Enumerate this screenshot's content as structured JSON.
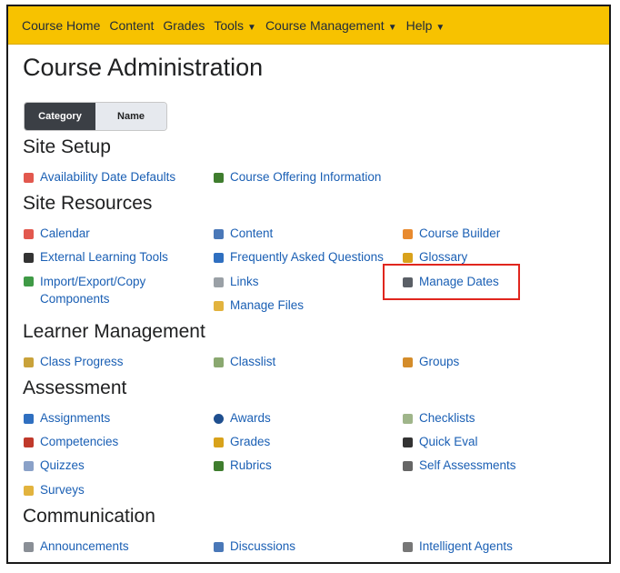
{
  "nav": {
    "items": [
      {
        "label": "Course Home",
        "dropdown": false
      },
      {
        "label": "Content",
        "dropdown": false
      },
      {
        "label": "Grades",
        "dropdown": false
      },
      {
        "label": "Tools",
        "dropdown": true
      },
      {
        "label": "Course Management",
        "dropdown": true
      },
      {
        "label": "Help",
        "dropdown": true
      }
    ],
    "chevron": "⌄"
  },
  "page": {
    "title": "Course Administration"
  },
  "view_toggle": {
    "category_label": "Category",
    "name_label": "Name",
    "selected": "Category"
  },
  "sections": {
    "site_setup": {
      "title": "Site Setup",
      "links": {
        "availability_date_defaults": "Availability Date Defaults",
        "course_offering_information": "Course Offering Information"
      }
    },
    "site_resources": {
      "title": "Site Resources",
      "links": {
        "calendar": "Calendar",
        "content": "Content",
        "course_builder": "Course Builder",
        "external_learning_tools": "External Learning Tools",
        "faq": "Frequently Asked Questions",
        "glossary": "Glossary",
        "import_export_copy": "Import/Export/Copy Components",
        "links": "Links",
        "manage_dates": "Manage Dates",
        "manage_files": "Manage Files"
      }
    },
    "learner_management": {
      "title": "Learner Management",
      "links": {
        "class_progress": "Class Progress",
        "classlist": "Classlist",
        "groups": "Groups"
      }
    },
    "assessment": {
      "title": "Assessment",
      "links": {
        "assignments": "Assignments",
        "awards": "Awards",
        "checklists": "Checklists",
        "competencies": "Competencies",
        "grades": "Grades",
        "quick_eval": "Quick Eval",
        "quizzes": "Quizzes",
        "rubrics": "Rubrics",
        "self_assessments": "Self Assessments",
        "surveys": "Surveys"
      }
    },
    "communication": {
      "title": "Communication",
      "links": {
        "announcements": "Announcements",
        "discussions": "Discussions",
        "intelligent_agents": "Intelligent Agents"
      }
    }
  },
  "colors": {
    "navbar": "#f7c200",
    "link": "#1a5fb4",
    "highlight": "#e0261e",
    "toggle_active": "#3b3f45"
  }
}
